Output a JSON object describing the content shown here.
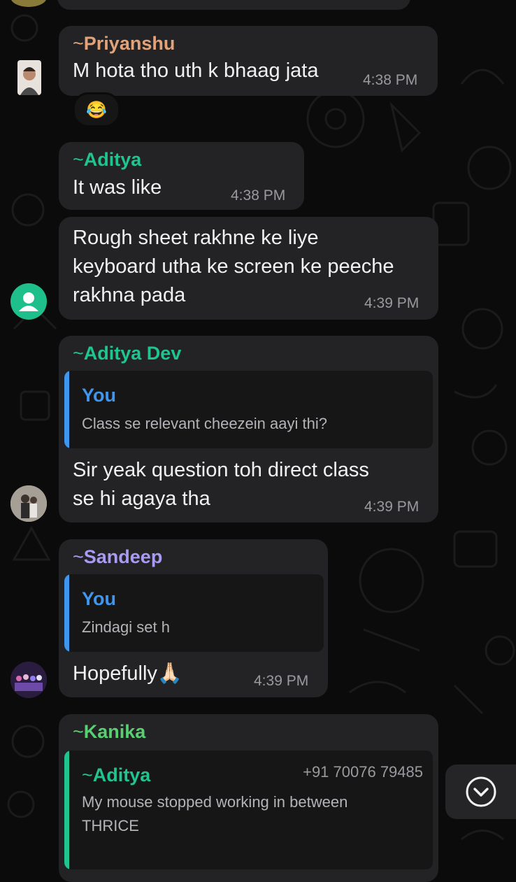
{
  "messages": [
    {
      "sender": "Priyanshu",
      "text_lines": [
        "M hota tho uth k bhaag jata"
      ],
      "time": "4:38 PM",
      "reaction": "😂",
      "name_color": "#e2a27a"
    },
    {
      "sender": "Aditya",
      "text_lines": [
        "It was like"
      ],
      "time": "4:38 PM",
      "name_color": "#1fc48e"
    },
    {
      "sender": "",
      "text_lines": [
        "Rough sheet rakhne ke liye",
        "keyboard utha ke screen ke peeche",
        "rakhna pada"
      ],
      "time": "4:39 PM"
    },
    {
      "sender": "Aditya Dev",
      "quote": {
        "name": "You",
        "text_lines": [
          "Class se relevant cheezein aayi thi?"
        ]
      },
      "text_lines": [
        "Sir yeak question toh direct class",
        "se hi agaya tha"
      ],
      "time": "4:39 PM",
      "name_color": "#1fc48e"
    },
    {
      "sender": "Sandeep",
      "quote": {
        "name": "You",
        "text_lines": [
          "Zindagi set h"
        ]
      },
      "text_lines": [
        "Hopefully🙏🏻"
      ],
      "time": "4:39 PM",
      "name_color": "#a99af2"
    },
    {
      "sender": "Kanika",
      "quote": {
        "name": "Aditya",
        "phone": "+91 70076 79485",
        "text_lines": [
          "My mouse stopped working in between",
          "THRICE"
        ]
      },
      "name_color": "#59cf72"
    }
  ],
  "tilde": "~",
  "colors": {
    "background": "#0b0b0b",
    "bubble": "#232325",
    "quote_bg": "#161617",
    "you_accent": "#3f96ef",
    "aditya_quote_accent": "#1fc48e",
    "timestamp": "#9a9a9e"
  },
  "icons": {
    "scroll_down": "chevron-down-circle-icon",
    "default_avatar": "person-icon"
  }
}
